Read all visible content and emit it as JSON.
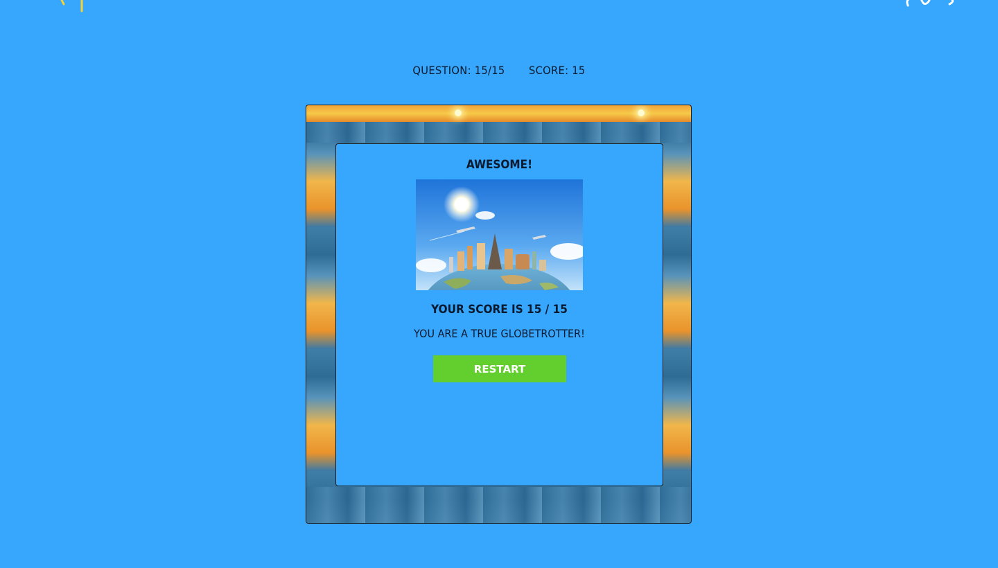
{
  "status": {
    "question_label": "QUESTION: 15/15",
    "score_label": "SCORE: 15"
  },
  "result": {
    "headline": "AWESOME!",
    "score_text": "YOUR SCORE IS 15 / 15",
    "message": "YOU ARE A TRUE GLOBETROTTER!",
    "restart_label": "RESTART"
  },
  "icons": {
    "top_left": "sun-icon",
    "top_right": "cloud-icon",
    "result_image": "world-landmarks-illustration"
  },
  "colors": {
    "page_background": "#37a6fd",
    "restart_button": "#62cf2e",
    "text": "#0a1a2e"
  }
}
